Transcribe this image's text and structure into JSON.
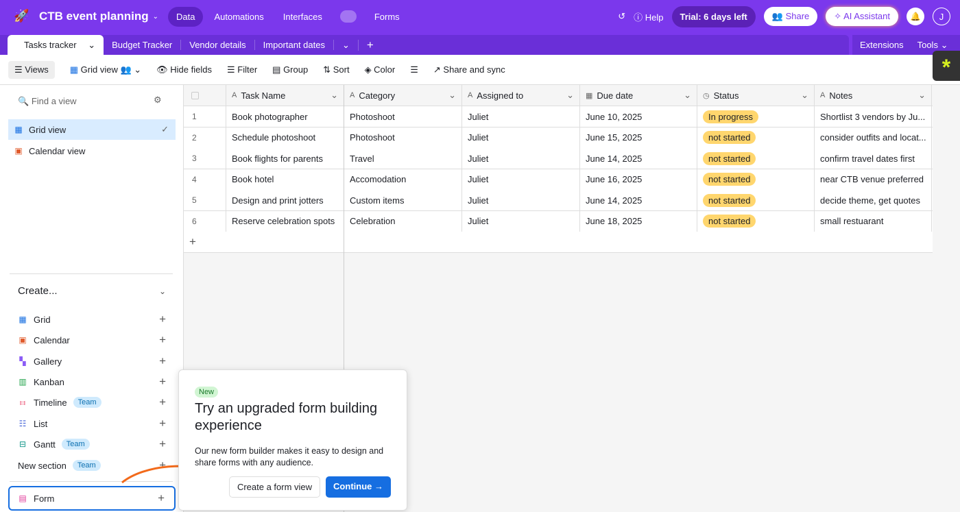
{
  "app": {
    "title": "CTB event planning",
    "nav": [
      "Data",
      "Automations",
      "Interfaces",
      "Forms"
    ],
    "help": "Help",
    "trial": "Trial: 6 days left",
    "share": "Share",
    "ai": "AI Assistant",
    "avatar": "J",
    "accent": "#7b38ec"
  },
  "tabs": {
    "items": [
      "Tasks tracker",
      "Budget Tracker",
      "Vendor details",
      "Important dates"
    ],
    "extensions": "Extensions",
    "tools": "Tools"
  },
  "toolbar": {
    "views": "Views",
    "grid_view": "Grid view",
    "hide_fields": "Hide fields",
    "filter": "Filter",
    "group": "Group",
    "sort": "Sort",
    "color": "Color",
    "share_sync": "Share and sync"
  },
  "sidebar": {
    "find_placeholder": "Find a view",
    "views": [
      "Grid view",
      "Calendar view"
    ],
    "create": "Create...",
    "create_items": [
      {
        "label": "Grid"
      },
      {
        "label": "Calendar"
      },
      {
        "label": "Gallery"
      },
      {
        "label": "Kanban"
      },
      {
        "label": "Timeline",
        "badge": "Team"
      },
      {
        "label": "List"
      },
      {
        "label": "Gantt",
        "badge": "Team"
      },
      {
        "label": "New section",
        "badge": "Team"
      }
    ],
    "form": "Form"
  },
  "table": {
    "columns": [
      "Task Name",
      "Category",
      "Assigned to",
      "Due date",
      "Status",
      "Notes"
    ],
    "rows": [
      [
        "1",
        "Book photographer",
        "Photoshoot",
        "Juliet",
        "June 10, 2025",
        "In progress",
        "Shortlist 3 vendors by Ju..."
      ],
      [
        "2",
        "Schedule photoshoot",
        "Photoshoot",
        "Juliet",
        "June 15, 2025",
        "not started",
        "consider outfits and locat..."
      ],
      [
        "3",
        "Book flights for parents",
        "Travel",
        "Juliet",
        "June 14, 2025",
        "not started",
        "confirm travel dates first"
      ],
      [
        "4",
        "Book hotel",
        "Accomodation",
        "Juliet",
        "June 16, 2025",
        "not started",
        "near CTB venue preferred"
      ],
      [
        "5",
        "Design and print jotters",
        "Custom items",
        "Juliet",
        "June 14, 2025",
        "not started",
        "decide theme, get quotes"
      ],
      [
        "6",
        "Reserve celebration spots",
        "Celebration",
        "Juliet",
        "June 18, 2025",
        "not started",
        "small restuarant"
      ]
    ]
  },
  "popup": {
    "badge": "New",
    "title": "Try an upgraded form building experience",
    "desc": "Our new form builder makes it easy to design and share forms with any audience.",
    "secondary": "Create a form view",
    "primary": "Continue"
  }
}
